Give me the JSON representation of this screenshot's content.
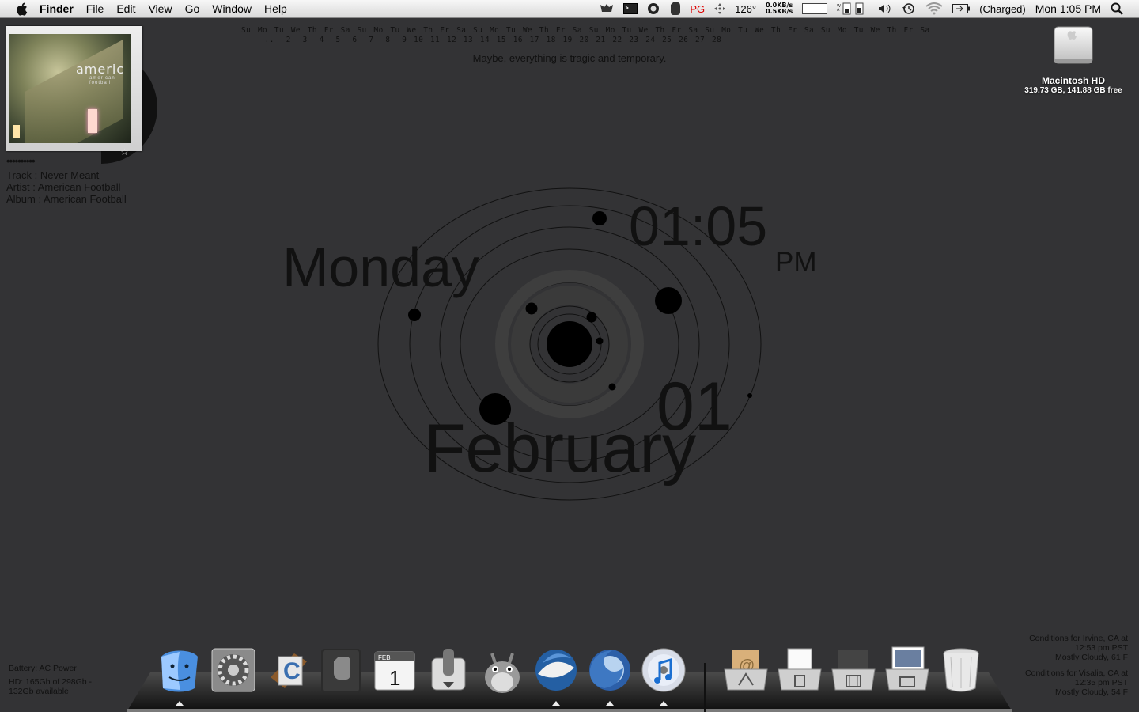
{
  "menubar": {
    "app_name": "Finder",
    "menus": [
      "File",
      "Edit",
      "View",
      "Go",
      "Window",
      "Help"
    ],
    "status_pg": "PG",
    "temperature": "126°",
    "net_up": "0.0KB/s",
    "net_down": "0.5KB/s",
    "battery_status": "(Charged)",
    "clock": "Mon 1:05 PM",
    "icons": [
      "apple-icon",
      "growl-icon",
      "terminal-icon",
      "quicksilver-icon",
      "evernote-icon",
      "move-icon",
      "cpu-graph-icon",
      "memory-icon",
      "volume-icon",
      "time-machine-icon",
      "wifi-icon",
      "battery-icon",
      "spotlight-icon"
    ]
  },
  "calendar": {
    "weekdays": [
      "Su",
      "Mo",
      "Tu",
      "We",
      "Th",
      "Fr",
      "Sa",
      "Su",
      "Mo",
      "Tu",
      "We",
      "Th",
      "Fr",
      "Sa",
      "Su",
      "Mo",
      "Tu",
      "We",
      "Th",
      "Fr",
      "Sa",
      "Su",
      "Mo",
      "Tu",
      "We",
      "Th",
      "Fr",
      "Sa",
      "Su",
      "Mo",
      "Tu",
      "We",
      "Th",
      "Fr",
      "Sa",
      "Su",
      "Mo",
      "Tu",
      "We",
      "Th",
      "Fr",
      "Sa"
    ],
    "dates": [
      "",
      "..",
      "2",
      "3",
      "4",
      "5",
      "6",
      "7",
      "8",
      "9",
      "10",
      "11",
      "12",
      "13",
      "14",
      "15",
      "16",
      "17",
      "18",
      "19",
      "20",
      "21",
      "22",
      "23",
      "24",
      "25",
      "26",
      "27",
      "28"
    ]
  },
  "quote": "Maybe, everything is tragic and temporary.",
  "nowplaying": {
    "cover_title": "americ",
    "cover_subtitle": "american football",
    "rating": "••••••••••",
    "track": "Track  : Never Meant",
    "artist": "Artist : American Football",
    "album": "Album  : American Football"
  },
  "drive": {
    "name": "Macintosh HD",
    "capacity": "319.73 GB, 141.88 GB free"
  },
  "clock": {
    "day": "Monday",
    "time": "01:05",
    "ampm": "PM",
    "date": "01",
    "month": "February"
  },
  "system": {
    "battery": "Battery:  AC Power",
    "hd_line1": "HD:  165Gb of 298Gb -",
    "hd_line2": "132Gb available"
  },
  "weather": [
    {
      "line1": "Conditions for Irvine, CA at",
      "line2": "12:53 pm PST",
      "line3": "Mostly Cloudy, 61 F"
    },
    {
      "line1": "Conditions for Visalia, CA at",
      "line2": "12:35 pm PST",
      "line3": "Mostly Cloudy, 54 F"
    }
  ],
  "dock": {
    "items": [
      "finder",
      "system-preferences",
      "coda",
      "evernote",
      "ical",
      "switch",
      "totoro",
      "thunderbird",
      "firefox",
      "itunes",
      "applications-stack",
      "documents-stack",
      "movies-stack",
      "pictures-stack",
      "trash"
    ],
    "calendar_month": "FEB",
    "calendar_day": "1"
  }
}
